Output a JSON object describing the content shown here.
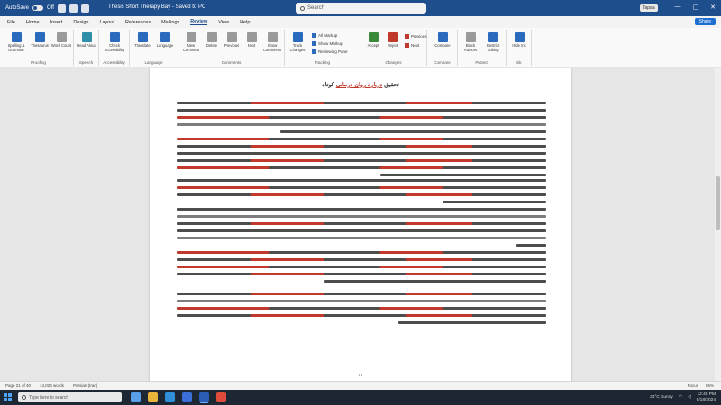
{
  "titlebar": {
    "autosave_label": "AutoSave",
    "autosave_state": "Off",
    "document_title": "Thesis Short Therapy Bay - Saved to PC",
    "search_placeholder": "Search",
    "user_label": "Tapaa",
    "minimize": "—",
    "maximize": "▢",
    "close": "✕"
  },
  "menu": {
    "tabs": [
      "File",
      "Home",
      "Insert",
      "Design",
      "Layout",
      "References",
      "Mailings",
      "Review",
      "View",
      "Help"
    ],
    "active": "Review",
    "share_label": "Share"
  },
  "ribbon": {
    "groups": [
      {
        "label": "Proofing",
        "buttons": [
          "Spelling & Grammar",
          "Thesaurus",
          "Word Count"
        ]
      },
      {
        "label": "Speech",
        "buttons": [
          "Read Aloud"
        ]
      },
      {
        "label": "Accessibility",
        "buttons": [
          "Check Accessibility"
        ]
      },
      {
        "label": "Language",
        "buttons": [
          "Translate",
          "Language"
        ]
      },
      {
        "label": "Comments",
        "buttons": [
          "New Comment",
          "Delete",
          "Previous",
          "Next",
          "Show Comments"
        ]
      },
      {
        "label": "Tracking",
        "buttons": [
          "Track Changes"
        ],
        "items": [
          "All Markup",
          "Show Markup",
          "Reviewing Pane"
        ]
      },
      {
        "label": "Changes",
        "buttons": [
          "Accept",
          "Reject"
        ],
        "items": [
          "Previous",
          "Next"
        ]
      },
      {
        "label": "Compare",
        "buttons": [
          "Compare"
        ]
      },
      {
        "label": "Protect",
        "buttons": [
          "Block Authors",
          "Restrict Editing"
        ]
      },
      {
        "label": "Ink",
        "buttons": [
          "Hide Ink"
        ]
      }
    ]
  },
  "document": {
    "heading_prefix": "تحقیق",
    "heading_highlight": "درباره روان درمانی",
    "heading_suffix": "کوتاه",
    "page_number": "۲۱"
  },
  "statusbar": {
    "page": "Page 21 of 40",
    "words": "14,026 words",
    "language": "Persian (Iran)",
    "view_label": "Focus",
    "zoom": "85%"
  },
  "taskbar": {
    "search_placeholder": "Type here to search",
    "weather": "24°C Sunny",
    "time": "12:40 PM",
    "date": "6/18/2024"
  }
}
